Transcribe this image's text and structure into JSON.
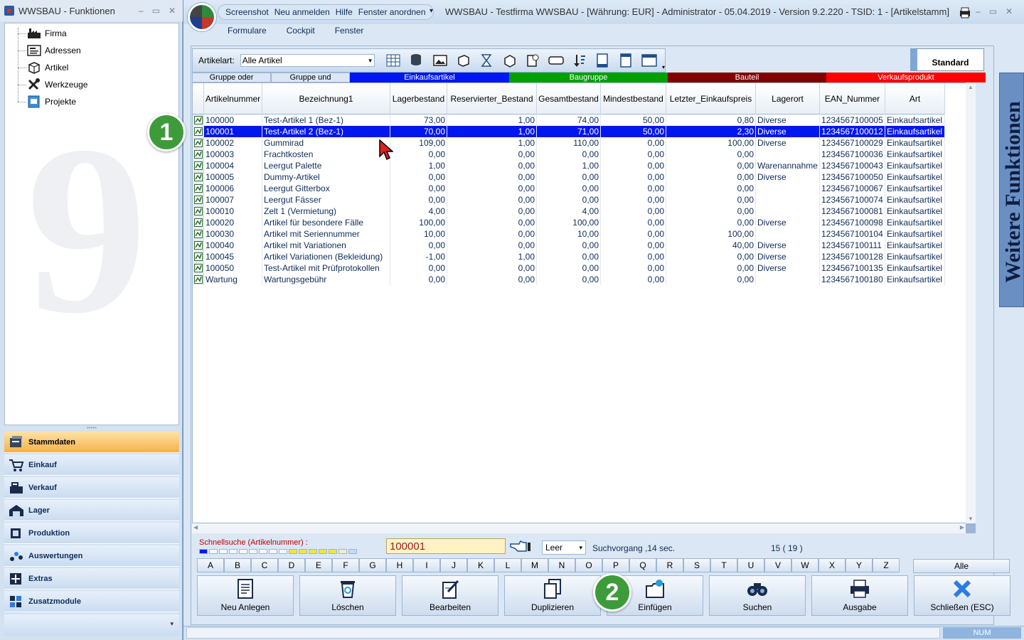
{
  "left_panel": {
    "title": "WWSBAU - Funktionen",
    "tree": [
      {
        "label": "Firma",
        "icon": "factory-icon"
      },
      {
        "label": "Adressen",
        "icon": "address-card-icon"
      },
      {
        "label": "Artikel",
        "icon": "box-icon"
      },
      {
        "label": "Werkzeuge",
        "icon": "tools-icon"
      },
      {
        "label": "Projekte",
        "icon": "project-icon"
      }
    ],
    "nav": [
      {
        "label": "Stammdaten",
        "icon": "master-data-icon",
        "active": true
      },
      {
        "label": "Einkauf",
        "icon": "cart-icon"
      },
      {
        "label": "Verkauf",
        "icon": "cash-register-icon"
      },
      {
        "label": "Lager",
        "icon": "warehouse-icon"
      },
      {
        "label": "Produktion",
        "icon": "production-icon"
      },
      {
        "label": "Auswertungen",
        "icon": "analytics-icon"
      },
      {
        "label": "Extras",
        "icon": "extras-icon"
      },
      {
        "label": "Zusatzmodule",
        "icon": "modules-icon"
      }
    ]
  },
  "main": {
    "qat": [
      "Screenshot",
      "Neu anmelden",
      "Hilfe",
      "Fenster anordnen"
    ],
    "title": "WWSBAU - Testfirma WWSBAU - [Währung: EUR] - Administrator - 05.04.2019 - Version 9.2.220 - TSID: 1  - [Artikelstamm]",
    "tabs": [
      "Formulare",
      "Cockpit",
      "Fenster"
    ],
    "artikelart_label": "Artikelart:",
    "artikelart_value": "Alle Artikel",
    "standard_label": "Standard",
    "side_panel_label": "Weitere Funktionen"
  },
  "groupbar": [
    {
      "label": "Gruppe oder",
      "color": "#dbe7f4",
      "text": "#000000"
    },
    {
      "label": "Gruppe und",
      "color": "#dbe7f4",
      "text": "#000000"
    },
    {
      "label": "Einkaufsartikel",
      "color": "#0017ee",
      "text": "#ffffff"
    },
    {
      "label": "Baugruppe",
      "color": "#00a000",
      "text": "#ffffff"
    },
    {
      "label": "Bauteil",
      "color": "#800000",
      "text": "#ffffff"
    },
    {
      "label": "Verkaufsprodukt",
      "color": "#ff0000",
      "text": "#ffffff"
    }
  ],
  "table": {
    "columns": [
      "Artikelnummer",
      "Bezeichnung1",
      "Lagerbestand",
      "Reservierter_Bestand",
      "Gesamtbestand",
      "Mindestbestand",
      "Letzter_Einkaufspreis",
      "Lagerort",
      "EAN_Nummer",
      "Art"
    ],
    "selected_index": 1,
    "rows": [
      [
        "100000",
        "Test-Artikel 1  (Bez-1)",
        "73,00",
        "1,00",
        "74,00",
        "50,00",
        "0,80",
        "Diverse",
        "1234567100005",
        "Einkaufsartikel"
      ],
      [
        "100001",
        "Test-Artikel 2  (Bez-1)",
        "70,00",
        "1,00",
        "71,00",
        "50,00",
        "2,30",
        "Diverse",
        "1234567100012",
        "Einkaufsartikel"
      ],
      [
        "100002",
        "Gummirad",
        "109,00",
        "1,00",
        "110,00",
        "0,00",
        "100,00",
        "Diverse",
        "1234567100029",
        "Einkaufsartikel"
      ],
      [
        "100003",
        "Frachtkosten",
        "0,00",
        "0,00",
        "0,00",
        "0,00",
        "0,00",
        "",
        "1234567100036",
        "Einkaufsartikel"
      ],
      [
        "100004",
        "Leergut Palette",
        "1,00",
        "0,00",
        "1,00",
        "0,00",
        "0,00",
        "Warenannahme",
        "1234567100043",
        "Einkaufsartikel"
      ],
      [
        "100005",
        "Dummy-Artikel",
        "0,00",
        "0,00",
        "0,00",
        "0,00",
        "0,00",
        "Diverse",
        "1234567100050",
        "Einkaufsartikel"
      ],
      [
        "100006",
        "Leergut Gitterbox",
        "0,00",
        "0,00",
        "0,00",
        "0,00",
        "0,00",
        "",
        "1234567100067",
        "Einkaufsartikel"
      ],
      [
        "100007",
        "Leergut Fässer",
        "0,00",
        "0,00",
        "0,00",
        "0,00",
        "0,00",
        "",
        "1234567100074",
        "Einkaufsartikel"
      ],
      [
        "100010",
        "Zelt 1 (Vermietung)",
        "4,00",
        "0,00",
        "4,00",
        "0,00",
        "0,00",
        "",
        "1234567100081",
        "Einkaufsartikel"
      ],
      [
        "100020",
        "Artikel für besondere Fälle",
        "100,00",
        "0,00",
        "100,00",
        "0,00",
        "0,00",
        "Diverse",
        "1234567100098",
        "Einkaufsartikel"
      ],
      [
        "100030",
        "Artikel mit Seriennummer",
        "10,00",
        "0,00",
        "10,00",
        "0,00",
        "100,00",
        "",
        "1234567100104",
        "Einkaufsartikel"
      ],
      [
        "100040",
        "Artikel mit Variationen",
        "0,00",
        "0,00",
        "0,00",
        "0,00",
        "40,00",
        "Diverse",
        "1234567100111",
        "Einkaufsartikel"
      ],
      [
        "100045",
        "Artikel Variationen (Bekleidung)",
        "-1,00",
        "1,00",
        "0,00",
        "0,00",
        "0,00",
        "Diverse",
        "1234567100128",
        "Einkaufsartikel"
      ],
      [
        "100050",
        "Test-Artikel mit Prüfprotokollen",
        "0,00",
        "0,00",
        "0,00",
        "0,00",
        "0,00",
        "Diverse",
        "1234567100135",
        "Einkaufsartikel"
      ],
      [
        "Wartung",
        "Wartungsgebühr",
        "0,00",
        "0,00",
        "0,00",
        "0,00",
        "0,00",
        "",
        "1234567100180",
        "Einkaufsartikel"
      ]
    ]
  },
  "search": {
    "label": "Schnellsuche (Artikelnummer) :",
    "value": "100001",
    "mode": "Leer",
    "timing": "Suchvorgang ,14 sec.",
    "count": "15  ( 19 )"
  },
  "alphabet": [
    "A",
    "B",
    "C",
    "D",
    "E",
    "F",
    "G",
    "H",
    "I",
    "J",
    "K",
    "L",
    "M",
    "N",
    "O",
    "P",
    "Q",
    "R",
    "S",
    "T",
    "U",
    "V",
    "W",
    "X",
    "Y",
    "Z"
  ],
  "alle_label": "Alle",
  "actions": [
    {
      "label": "Neu Anlegen",
      "icon": "new-document-icon"
    },
    {
      "label": "Löschen",
      "icon": "recycle-bin-icon"
    },
    {
      "label": "Bearbeiten",
      "icon": "edit-icon"
    },
    {
      "label": "Duplizieren",
      "icon": "duplicate-icon"
    },
    {
      "label": "Einfügen",
      "icon": "paste-folder-icon"
    },
    {
      "label": "Suchen",
      "icon": "binoculars-icon"
    },
    {
      "label": "Ausgabe",
      "icon": "printer-icon"
    },
    {
      "label": "Schließen (ESC)",
      "icon": "close-x-icon"
    }
  ],
  "status": {
    "num": "NUM"
  },
  "badges": [
    "1",
    "2"
  ]
}
